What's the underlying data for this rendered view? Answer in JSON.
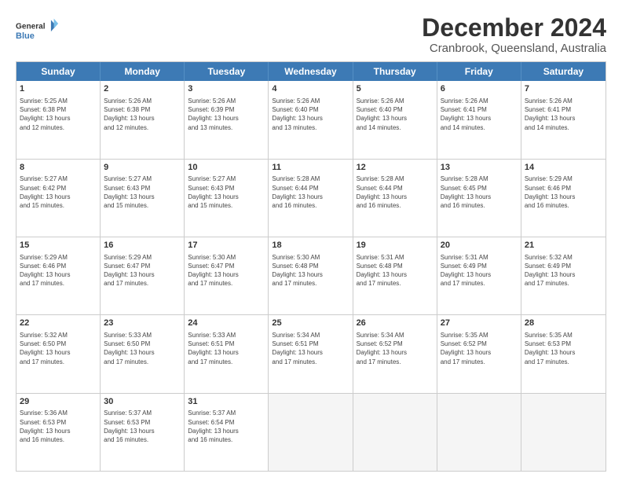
{
  "logo": {
    "line1": "General",
    "line2": "Blue"
  },
  "title": "December 2024",
  "subtitle": "Cranbrook, Queensland, Australia",
  "days": [
    "Sunday",
    "Monday",
    "Tuesday",
    "Wednesday",
    "Thursday",
    "Friday",
    "Saturday"
  ],
  "weeks": [
    [
      {
        "day": "1",
        "info": "Sunrise: 5:25 AM\nSunset: 6:38 PM\nDaylight: 13 hours\nand 12 minutes."
      },
      {
        "day": "2",
        "info": "Sunrise: 5:26 AM\nSunset: 6:38 PM\nDaylight: 13 hours\nand 12 minutes."
      },
      {
        "day": "3",
        "info": "Sunrise: 5:26 AM\nSunset: 6:39 PM\nDaylight: 13 hours\nand 13 minutes."
      },
      {
        "day": "4",
        "info": "Sunrise: 5:26 AM\nSunset: 6:40 PM\nDaylight: 13 hours\nand 13 minutes."
      },
      {
        "day": "5",
        "info": "Sunrise: 5:26 AM\nSunset: 6:40 PM\nDaylight: 13 hours\nand 14 minutes."
      },
      {
        "day": "6",
        "info": "Sunrise: 5:26 AM\nSunset: 6:41 PM\nDaylight: 13 hours\nand 14 minutes."
      },
      {
        "day": "7",
        "info": "Sunrise: 5:26 AM\nSunset: 6:41 PM\nDaylight: 13 hours\nand 14 minutes."
      }
    ],
    [
      {
        "day": "8",
        "info": "Sunrise: 5:27 AM\nSunset: 6:42 PM\nDaylight: 13 hours\nand 15 minutes."
      },
      {
        "day": "9",
        "info": "Sunrise: 5:27 AM\nSunset: 6:43 PM\nDaylight: 13 hours\nand 15 minutes."
      },
      {
        "day": "10",
        "info": "Sunrise: 5:27 AM\nSunset: 6:43 PM\nDaylight: 13 hours\nand 15 minutes."
      },
      {
        "day": "11",
        "info": "Sunrise: 5:28 AM\nSunset: 6:44 PM\nDaylight: 13 hours\nand 16 minutes."
      },
      {
        "day": "12",
        "info": "Sunrise: 5:28 AM\nSunset: 6:44 PM\nDaylight: 13 hours\nand 16 minutes."
      },
      {
        "day": "13",
        "info": "Sunrise: 5:28 AM\nSunset: 6:45 PM\nDaylight: 13 hours\nand 16 minutes."
      },
      {
        "day": "14",
        "info": "Sunrise: 5:29 AM\nSunset: 6:46 PM\nDaylight: 13 hours\nand 16 minutes."
      }
    ],
    [
      {
        "day": "15",
        "info": "Sunrise: 5:29 AM\nSunset: 6:46 PM\nDaylight: 13 hours\nand 17 minutes."
      },
      {
        "day": "16",
        "info": "Sunrise: 5:29 AM\nSunset: 6:47 PM\nDaylight: 13 hours\nand 17 minutes."
      },
      {
        "day": "17",
        "info": "Sunrise: 5:30 AM\nSunset: 6:47 PM\nDaylight: 13 hours\nand 17 minutes."
      },
      {
        "day": "18",
        "info": "Sunrise: 5:30 AM\nSunset: 6:48 PM\nDaylight: 13 hours\nand 17 minutes."
      },
      {
        "day": "19",
        "info": "Sunrise: 5:31 AM\nSunset: 6:48 PM\nDaylight: 13 hours\nand 17 minutes."
      },
      {
        "day": "20",
        "info": "Sunrise: 5:31 AM\nSunset: 6:49 PM\nDaylight: 13 hours\nand 17 minutes."
      },
      {
        "day": "21",
        "info": "Sunrise: 5:32 AM\nSunset: 6:49 PM\nDaylight: 13 hours\nand 17 minutes."
      }
    ],
    [
      {
        "day": "22",
        "info": "Sunrise: 5:32 AM\nSunset: 6:50 PM\nDaylight: 13 hours\nand 17 minutes."
      },
      {
        "day": "23",
        "info": "Sunrise: 5:33 AM\nSunset: 6:50 PM\nDaylight: 13 hours\nand 17 minutes."
      },
      {
        "day": "24",
        "info": "Sunrise: 5:33 AM\nSunset: 6:51 PM\nDaylight: 13 hours\nand 17 minutes."
      },
      {
        "day": "25",
        "info": "Sunrise: 5:34 AM\nSunset: 6:51 PM\nDaylight: 13 hours\nand 17 minutes."
      },
      {
        "day": "26",
        "info": "Sunrise: 5:34 AM\nSunset: 6:52 PM\nDaylight: 13 hours\nand 17 minutes."
      },
      {
        "day": "27",
        "info": "Sunrise: 5:35 AM\nSunset: 6:52 PM\nDaylight: 13 hours\nand 17 minutes."
      },
      {
        "day": "28",
        "info": "Sunrise: 5:35 AM\nSunset: 6:53 PM\nDaylight: 13 hours\nand 17 minutes."
      }
    ],
    [
      {
        "day": "29",
        "info": "Sunrise: 5:36 AM\nSunset: 6:53 PM\nDaylight: 13 hours\nand 16 minutes."
      },
      {
        "day": "30",
        "info": "Sunrise: 5:37 AM\nSunset: 6:53 PM\nDaylight: 13 hours\nand 16 minutes."
      },
      {
        "day": "31",
        "info": "Sunrise: 5:37 AM\nSunset: 6:54 PM\nDaylight: 13 hours\nand 16 minutes."
      },
      {
        "day": "",
        "info": ""
      },
      {
        "day": "",
        "info": ""
      },
      {
        "day": "",
        "info": ""
      },
      {
        "day": "",
        "info": ""
      }
    ]
  ]
}
